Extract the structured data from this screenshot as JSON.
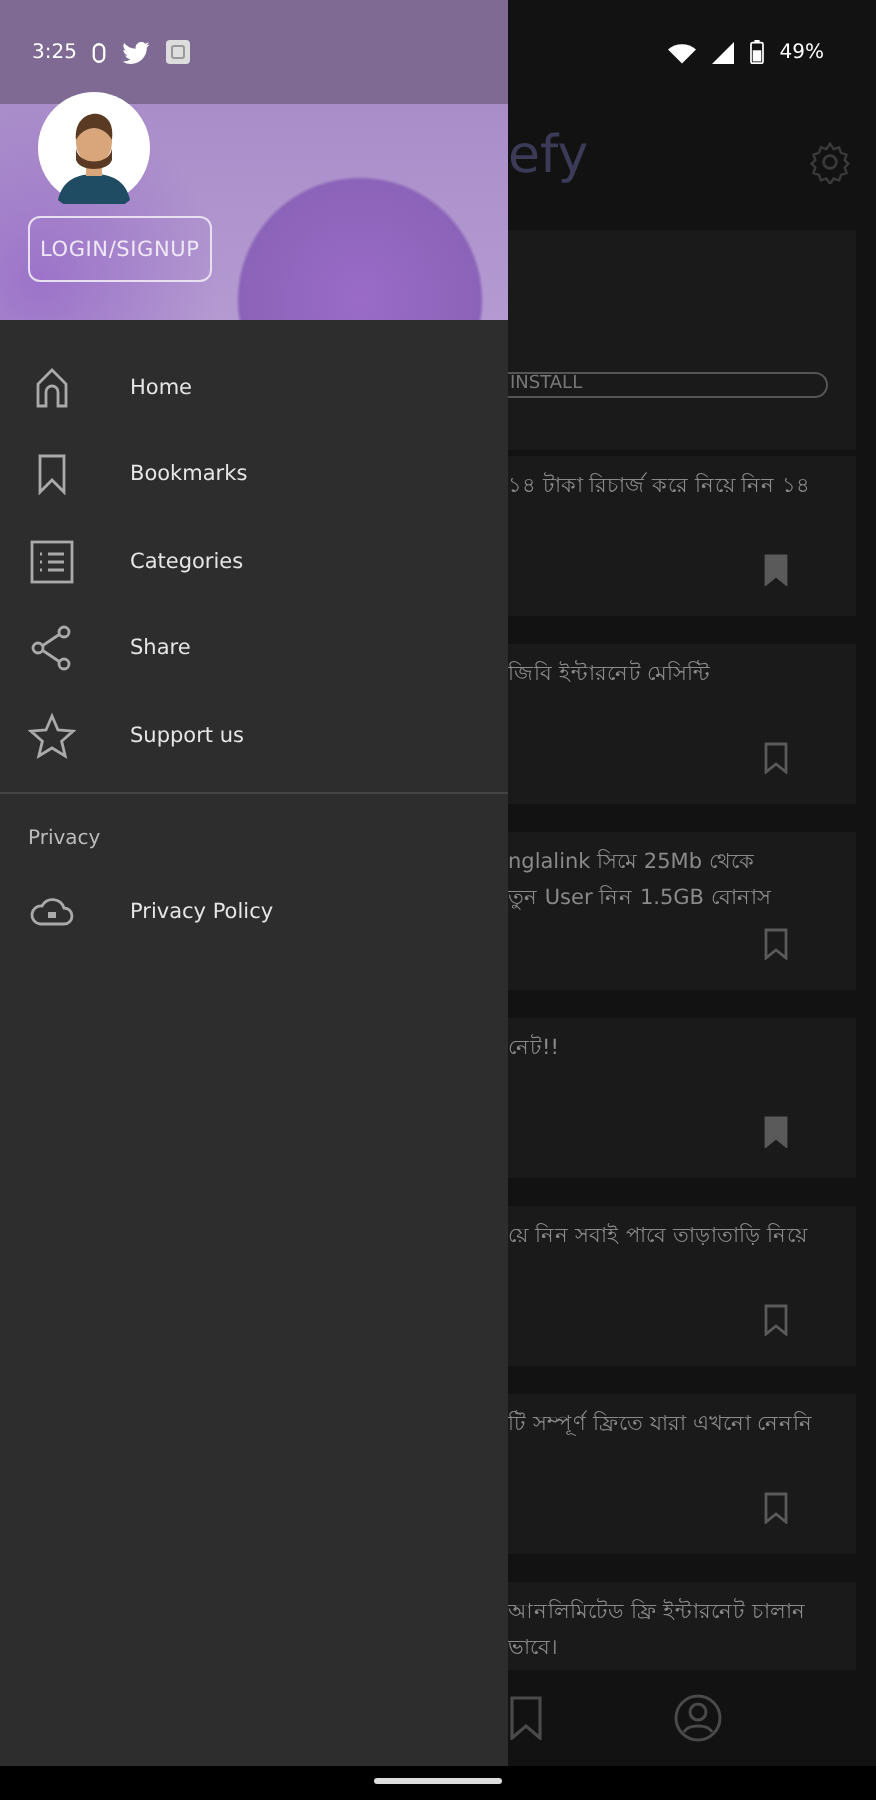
{
  "status_bar": {
    "time": "3:25",
    "battery": "49%"
  },
  "app_bar": {
    "title": "efy"
  },
  "ad_card": {
    "install_label": "INSTALL"
  },
  "posts": [
    {
      "lines": [
        "১৪ টাকা রিচার্জ করে নিয়ে নিন ১৪"
      ],
      "bookmarked": true
    },
    {
      "lines": [
        "জিবি ইন্টারনেট মেসিন্টি"
      ],
      "bookmarked": false
    },
    {
      "lines": [
        "nglalink সিমে 25Mb থেকে",
        "তুন User নিন 1.5GB বোনাস"
      ],
      "bookmarked": false
    },
    {
      "lines": [
        "নেট!!"
      ],
      "bookmarked": true
    },
    {
      "lines": [
        "য়ে নিন সবাই পাবে তাড়াতাড়ি নিয়ে"
      ],
      "bookmarked": false
    },
    {
      "lines": [
        "টি সম্পূর্ণ ফ্রিতে যারা এখনো নেননি"
      ],
      "bookmarked": false
    },
    {
      "lines": [
        "আনলিমিটেড ফ্রি ইন্টারনেট চালান",
        "ভাবে।"
      ]
    }
  ],
  "drawer": {
    "login_button": "LOGIN/SIGNUP",
    "items": [
      {
        "label": "Home"
      },
      {
        "label": "Bookmarks"
      },
      {
        "label": "Categories"
      },
      {
        "label": "Share"
      },
      {
        "label": "Support us"
      }
    ],
    "section_heading": "Privacy",
    "section_items": [
      {
        "label": "Privacy Policy"
      }
    ]
  }
}
